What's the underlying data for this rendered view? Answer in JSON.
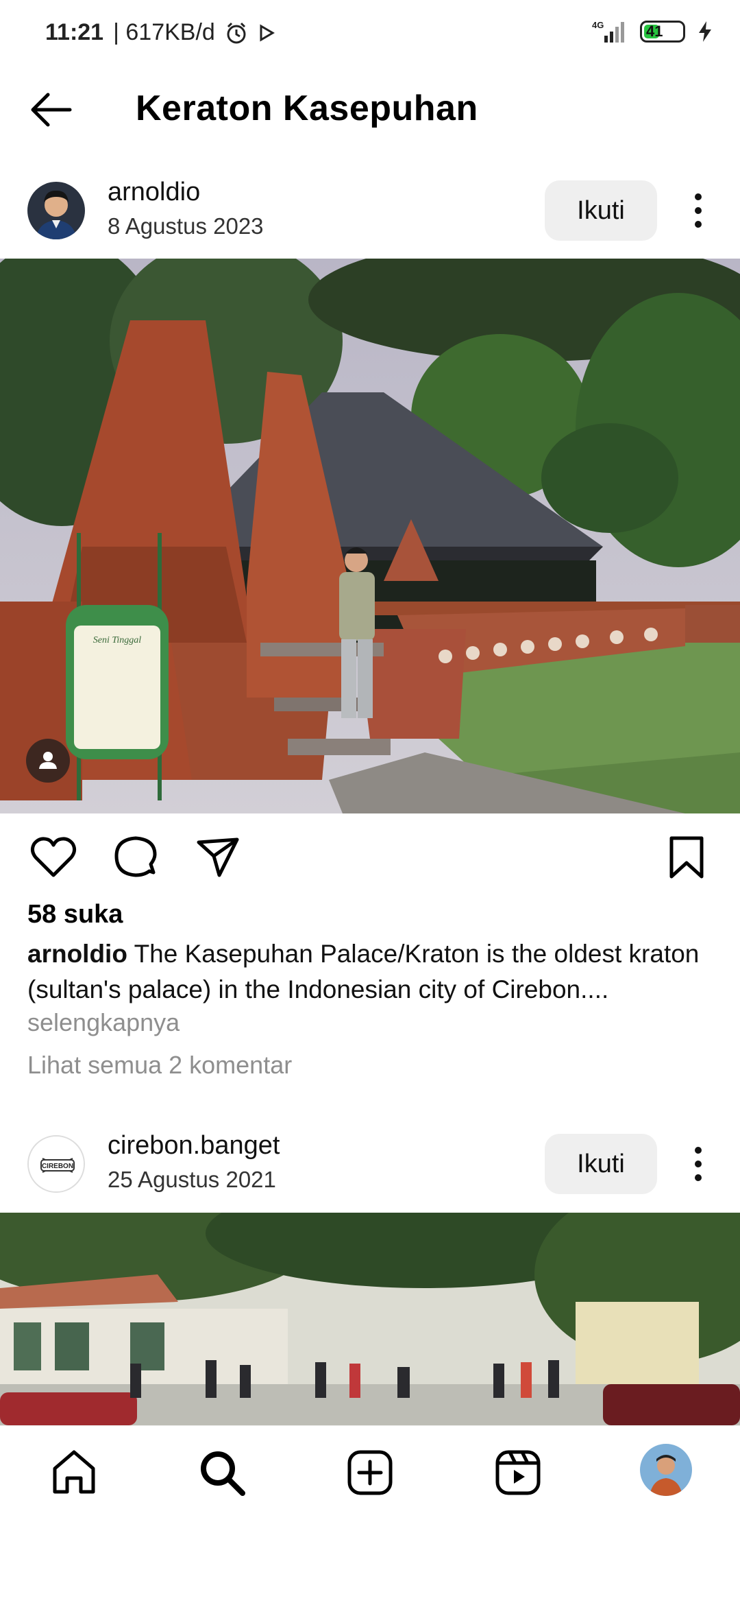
{
  "status_bar": {
    "time": "11:21",
    "data_rate": "| 617KB/d",
    "network": "4G",
    "battery": "41",
    "battery_level": 0.41
  },
  "header": {
    "title": "Keraton Kasepuhan"
  },
  "post1": {
    "username": "arnoldio",
    "date": "8 Agustus 2023",
    "follow_label": "Ikuti",
    "likes": "58 suka",
    "caption_user": "arnoldio",
    "caption_text": "The Kasepuhan Palace/Kraton is the oldest kraton (sultan's palace) in the Indonesian city of Cirebon....",
    "more_label": "selengkapnya",
    "comments_label": "Lihat semua 2 komentar",
    "sign_text": "Seni Tinggal"
  },
  "post2": {
    "username": "cirebon.banget",
    "date": "25 Agustus 2021",
    "follow_label": "Ikuti",
    "avatar_text": "CIREBON"
  },
  "icons": {
    "back": "arrow-left-icon",
    "like": "heart-icon",
    "comment": "comment-bubble-icon",
    "share": "send-icon",
    "save": "bookmark-icon",
    "home": "home-icon",
    "search": "search-icon",
    "create": "plus-square-icon",
    "reels": "reels-icon"
  },
  "colors": {
    "follow_bg": "#efefef",
    "muted_text": "#8e8e8e",
    "battery_green": "#27c33f"
  }
}
